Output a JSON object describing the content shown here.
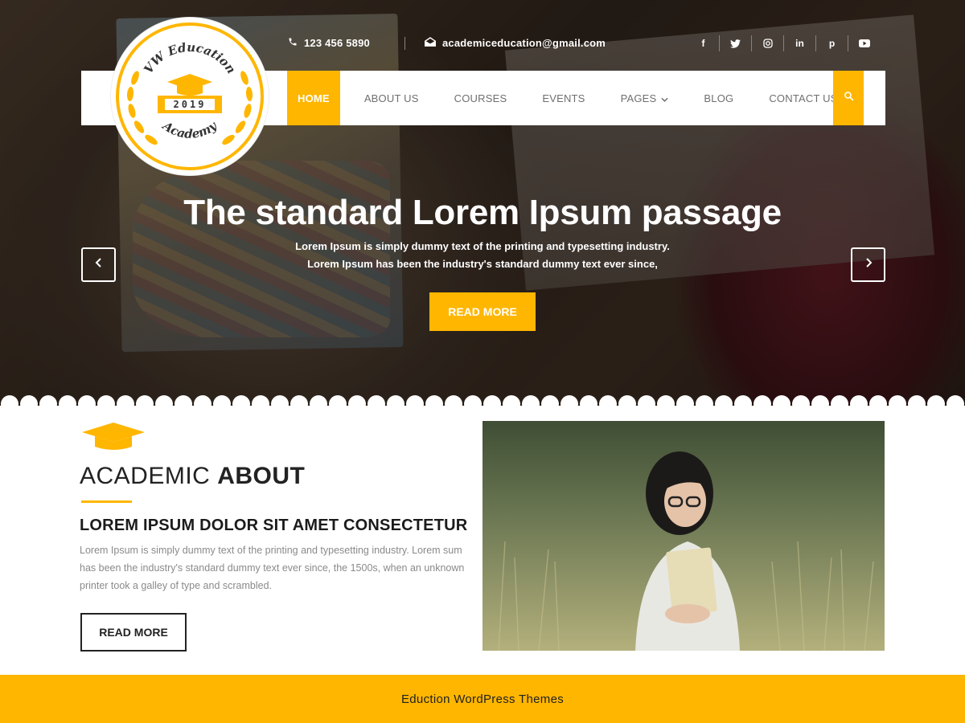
{
  "topbar": {
    "phone": "123 456 5890",
    "email": "academiceducation@gmail.com",
    "social": [
      {
        "icon": "facebook-icon",
        "glyph": "f"
      },
      {
        "icon": "twitter-icon",
        "glyph": "t"
      },
      {
        "icon": "instagram-icon",
        "glyph": "◎"
      },
      {
        "icon": "linkedin-icon",
        "glyph": "in"
      },
      {
        "icon": "pinterest-icon",
        "glyph": "p"
      },
      {
        "icon": "youtube-icon",
        "glyph": "▶"
      }
    ]
  },
  "logo": {
    "line1": "VW Education",
    "year": "2019",
    "line2": "Academy"
  },
  "nav": {
    "items": [
      "HOME",
      "ABOUT US",
      "COURSES",
      "EVENTS",
      "PAGES",
      "BLOG",
      "CONTACT US"
    ],
    "active": "HOME"
  },
  "hero": {
    "title": "The standard Lorem Ipsum passage",
    "text": "Lorem Ipsum is simply dummy text of the printing and typesetting industry. Lorem Ipsum has been the industry's standard dummy text ever since,",
    "button": "READ MORE"
  },
  "about": {
    "title_light": "ACADEMIC",
    "title_bold": "ABOUT",
    "subtitle": "LOREM IPSUM DOLOR SIT AMET CONSECTETUR",
    "text": "Lorem Ipsum is simply dummy text of the printing and typesetting industry. Lorem sum has been the industry's standard dummy text ever since, the 1500s, when an unknown printer took a galley of type and scrambled.",
    "button": "READ MORE"
  },
  "footer": {
    "text": "Eduction WordPress Themes"
  },
  "colors": {
    "accent": "#ffb600",
    "dark": "#222222",
    "muted": "#8a8a8a"
  }
}
